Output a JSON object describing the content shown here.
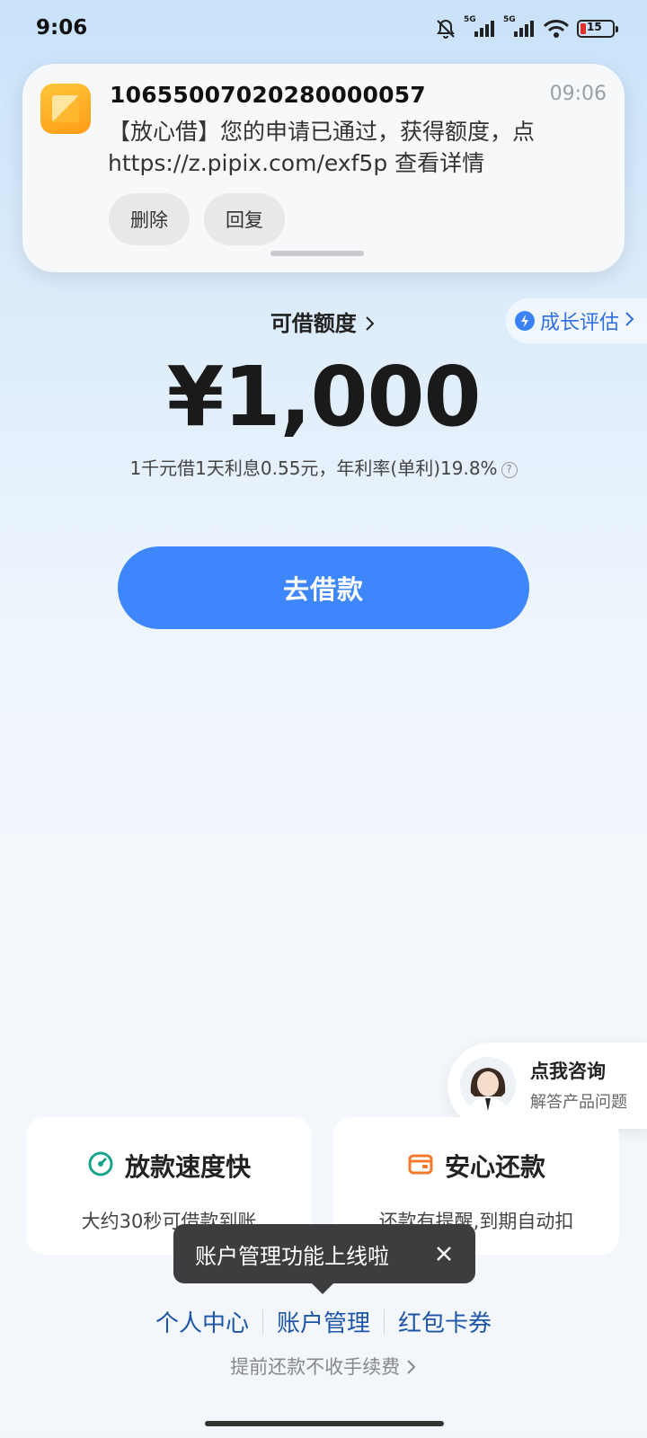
{
  "status_bar": {
    "time": "9:06",
    "network1": "5G",
    "network2": "5G",
    "battery": "15",
    "icons": [
      "bell-off-icon",
      "signal-icon",
      "signal-icon",
      "wifi-icon",
      "battery-icon"
    ]
  },
  "notification": {
    "sender": "10655007020280000057",
    "time": "09:06",
    "body_line1": "【放心借】您的申请已通过，获得额度，点",
    "body_line2": "https://z.pipix.com/exf5p 查看详情",
    "delete_label": "删除",
    "reply_label": "回复"
  },
  "growth": {
    "label": "成长评估"
  },
  "limit": {
    "title": "可借额度",
    "amount": "¥1,000",
    "rate_text": "1千元借1天利息0.55元，年利率(单利)19.8%"
  },
  "borrow_button": "去借款",
  "consult": {
    "title": "点我咨询",
    "subtitle": "解答产品问题"
  },
  "features": [
    {
      "title": "放款速度快",
      "desc": "大约30秒可借款到账",
      "icon": "speedometer-icon"
    },
    {
      "title": "安心还款",
      "desc": "还款有提醒,到期自动扣",
      "icon": "wallet-icon"
    }
  ],
  "tooltip": {
    "text": "账户管理功能上线啦"
  },
  "links": [
    "个人中心",
    "账户管理",
    "红包卡券"
  ],
  "prepay_text": "提前还款不收手续费",
  "colors": {
    "primary": "#3e86fb",
    "link": "#1d56a8",
    "accent_green": "#1aa58a",
    "accent_orange": "#f37a2a"
  }
}
